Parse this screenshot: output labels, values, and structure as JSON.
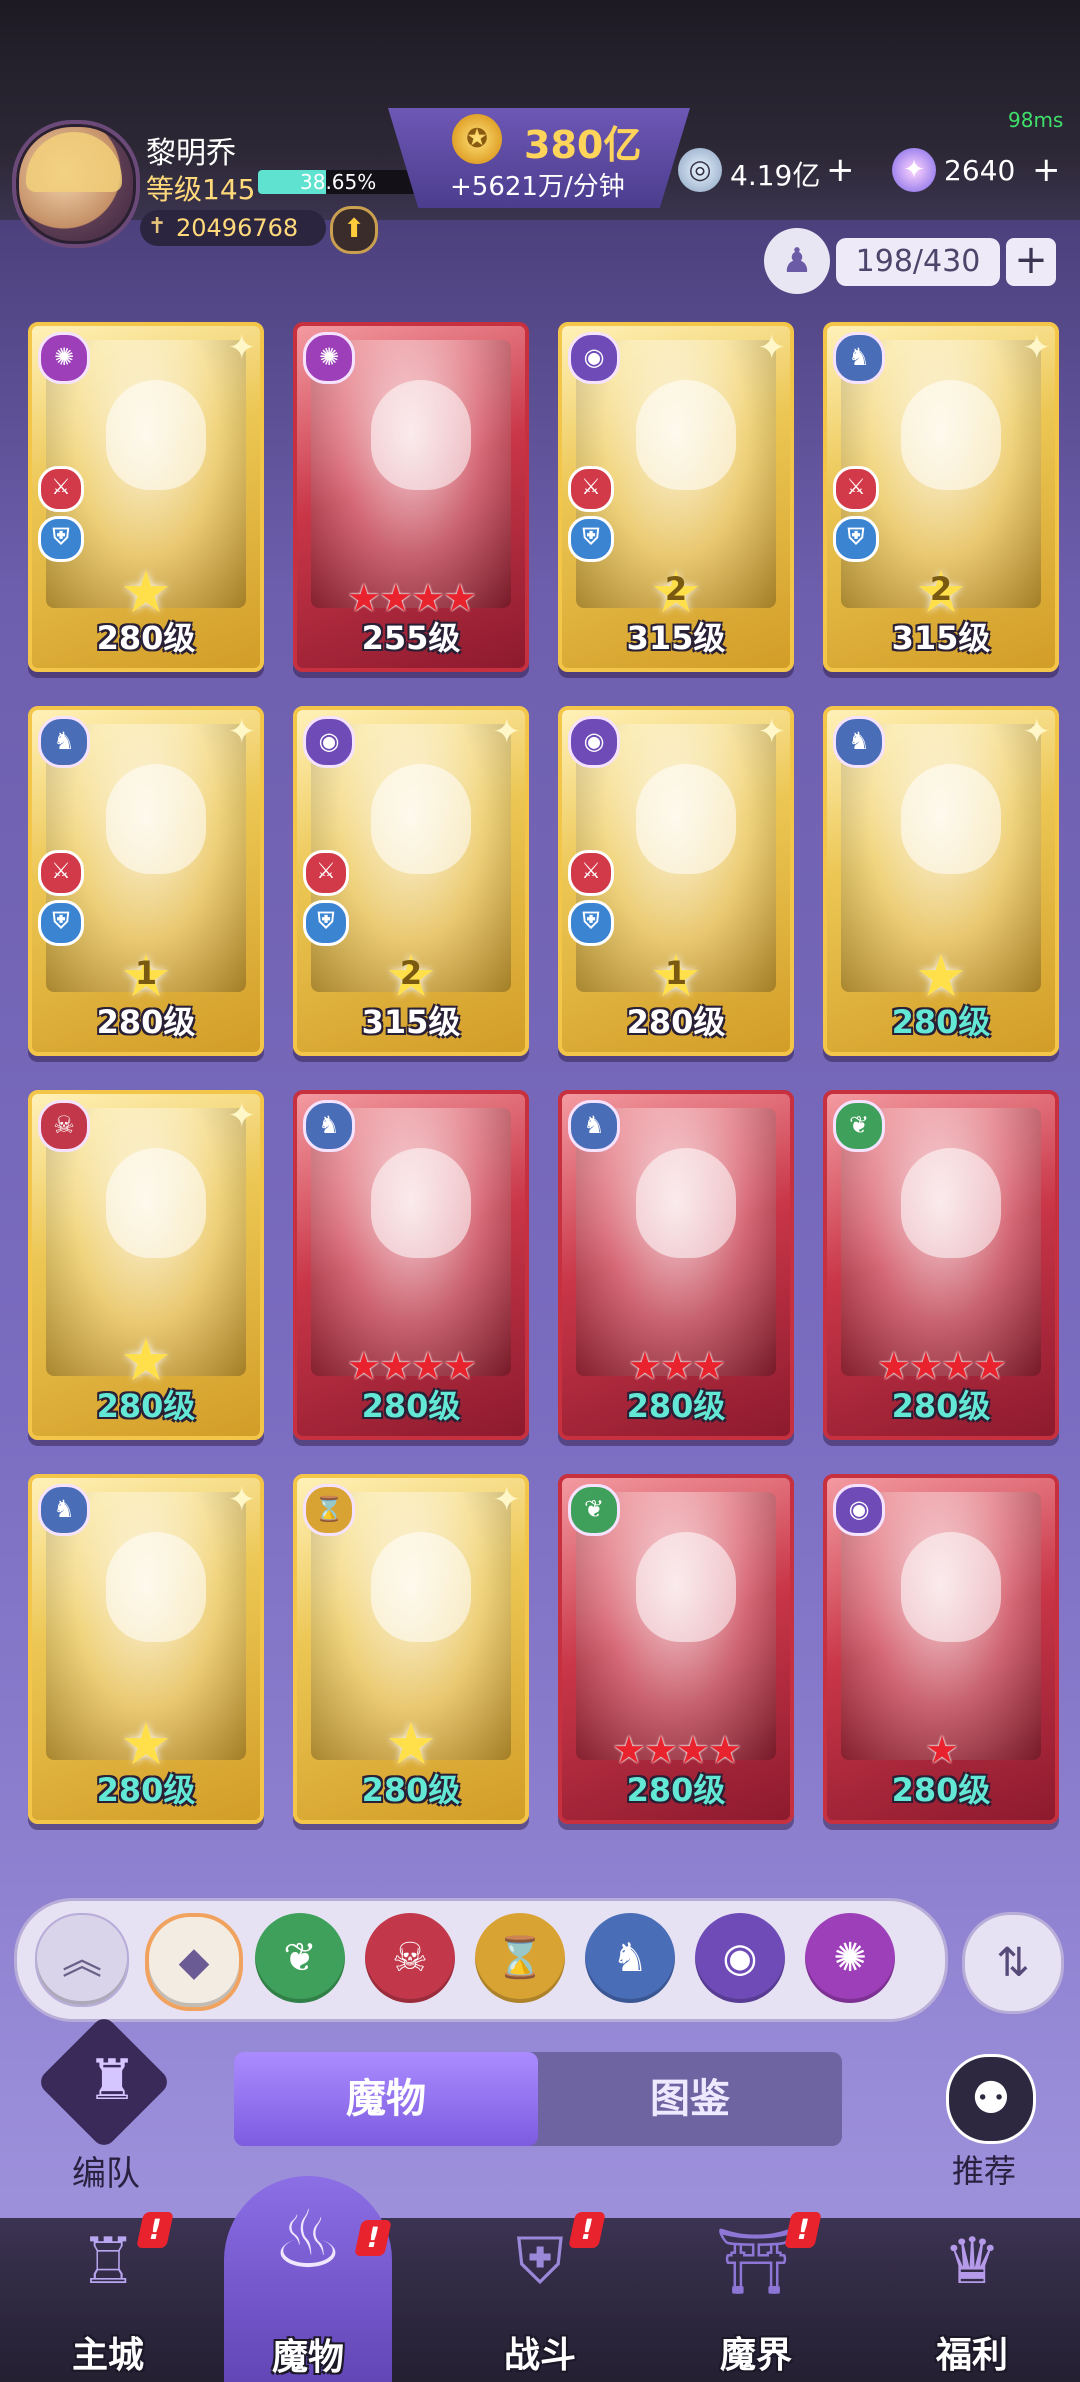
{
  "status": {
    "ping": "98ms"
  },
  "player": {
    "name": "黎明乔",
    "level_label": "等级145",
    "xp_percent": "38.65%",
    "xp_fraction": 0.3865,
    "power": "20496768"
  },
  "currency": {
    "gold": "380亿",
    "gold_rate": "+5621万/分钟",
    "crystal": "4.19亿",
    "gem": "2640"
  },
  "capacity": {
    "text": "198/430"
  },
  "cards": [
    {
      "level": "280级",
      "frame": "gold",
      "element": "vortex",
      "star_num": "",
      "red_stars": 0,
      "teal": false
    },
    {
      "level": "255级",
      "frame": "red",
      "element": "vortex",
      "star_num": "",
      "red_stars": 4,
      "teal": false
    },
    {
      "level": "315级",
      "frame": "gold",
      "element": "eye",
      "star_num": "2",
      "red_stars": 0,
      "teal": false
    },
    {
      "level": "315级",
      "frame": "gold",
      "element": "dragon",
      "star_num": "2",
      "red_stars": 0,
      "teal": false
    },
    {
      "level": "280级",
      "frame": "gold",
      "element": "dragon",
      "star_num": "1",
      "red_stars": 0,
      "teal": false
    },
    {
      "level": "315级",
      "frame": "gold",
      "element": "eye",
      "star_num": "2",
      "red_stars": 0,
      "teal": false
    },
    {
      "level": "280级",
      "frame": "gold",
      "element": "eye",
      "star_num": "1",
      "red_stars": 0,
      "teal": false
    },
    {
      "level": "280级",
      "frame": "gold",
      "element": "dragon",
      "star_num": "",
      "red_stars": 0,
      "teal": true
    },
    {
      "level": "280级",
      "frame": "gold",
      "element": "demon",
      "star_num": "",
      "red_stars": 0,
      "teal": true
    },
    {
      "level": "280级",
      "frame": "red",
      "element": "dragon",
      "star_num": "",
      "red_stars": 4,
      "teal": true
    },
    {
      "level": "280级",
      "frame": "red",
      "element": "dragon",
      "star_num": "",
      "red_stars": 3,
      "teal": true
    },
    {
      "level": "280级",
      "frame": "red",
      "element": "leaf",
      "star_num": "",
      "red_stars": 4,
      "teal": true
    },
    {
      "level": "280级",
      "frame": "gold",
      "element": "dragon",
      "star_num": "",
      "red_stars": 0,
      "teal": true
    },
    {
      "level": "280级",
      "frame": "gold",
      "element": "hourglass",
      "star_num": "",
      "red_stars": 0,
      "teal": true
    },
    {
      "level": "280级",
      "frame": "red",
      "element": "leaf",
      "star_num": "",
      "red_stars": 4,
      "teal": true
    },
    {
      "level": "280级",
      "frame": "red",
      "element": "eye",
      "star_num": "",
      "red_stars": 1,
      "teal": true
    }
  ],
  "filters": [
    "collapse-icon",
    "all-icon",
    "leaf-icon",
    "demon-icon",
    "hourglass-icon",
    "dragon-icon",
    "eye-icon",
    "vortex-icon"
  ],
  "tabs": {
    "monsters": "魔物",
    "codex": "图鉴"
  },
  "team": {
    "label": "编队"
  },
  "recommend": {
    "label": "推荐"
  },
  "nav": {
    "city": "主城",
    "monsters": "魔物",
    "battle": "战斗",
    "realm": "魔界",
    "welfare": "福利"
  },
  "colors": {
    "accent": "#7d5ce0",
    "gold": "#ffd45a",
    "alert": "#e8232e",
    "teal_level": "#63e8d6"
  }
}
